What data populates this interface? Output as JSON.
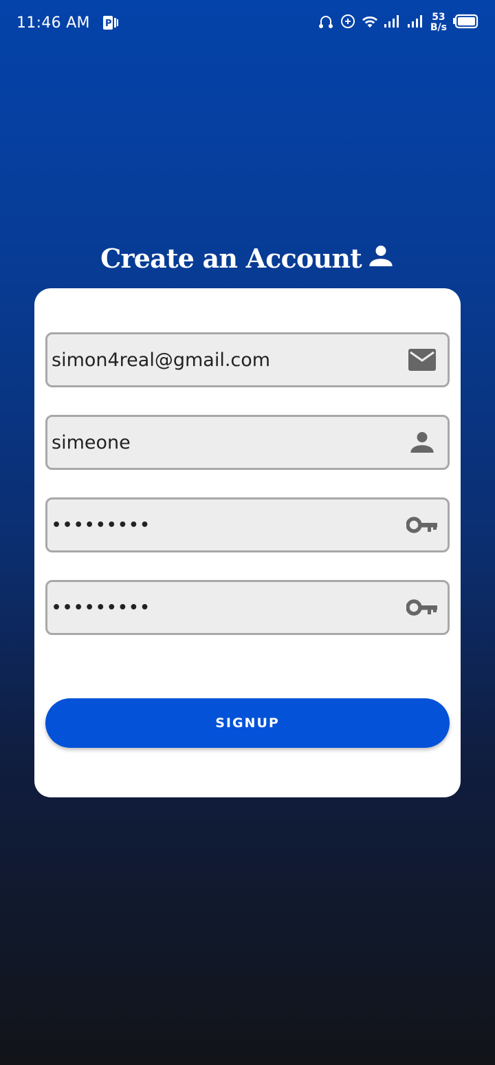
{
  "status_bar": {
    "time": "11:46 AM",
    "net_speed_value": "53",
    "net_speed_unit": "B/s",
    "icons": [
      "parking-notification-icon",
      "headset-icon",
      "data-saver-icon",
      "wifi-icon",
      "signal-icon",
      "signal-icon-2",
      "battery-icon"
    ]
  },
  "page": {
    "title": "Create an Account",
    "title_icon": "person-icon"
  },
  "form": {
    "email": {
      "value": "simon4real@gmail.com",
      "icon": "email-icon"
    },
    "username": {
      "value": "simeone",
      "icon": "person-icon"
    },
    "password": {
      "value": "•••••••••",
      "icon": "key-icon"
    },
    "confirm_password": {
      "value": "•••••••••",
      "icon": "key-icon"
    },
    "signup_label": "SIGNUP"
  },
  "colors": {
    "gradient_top": "#0443aa",
    "gradient_bottom": "#121419",
    "button": "#0352d8",
    "field_bg": "#ededed",
    "field_border": "#a8a8a8",
    "icon_gray": "#666666"
  }
}
